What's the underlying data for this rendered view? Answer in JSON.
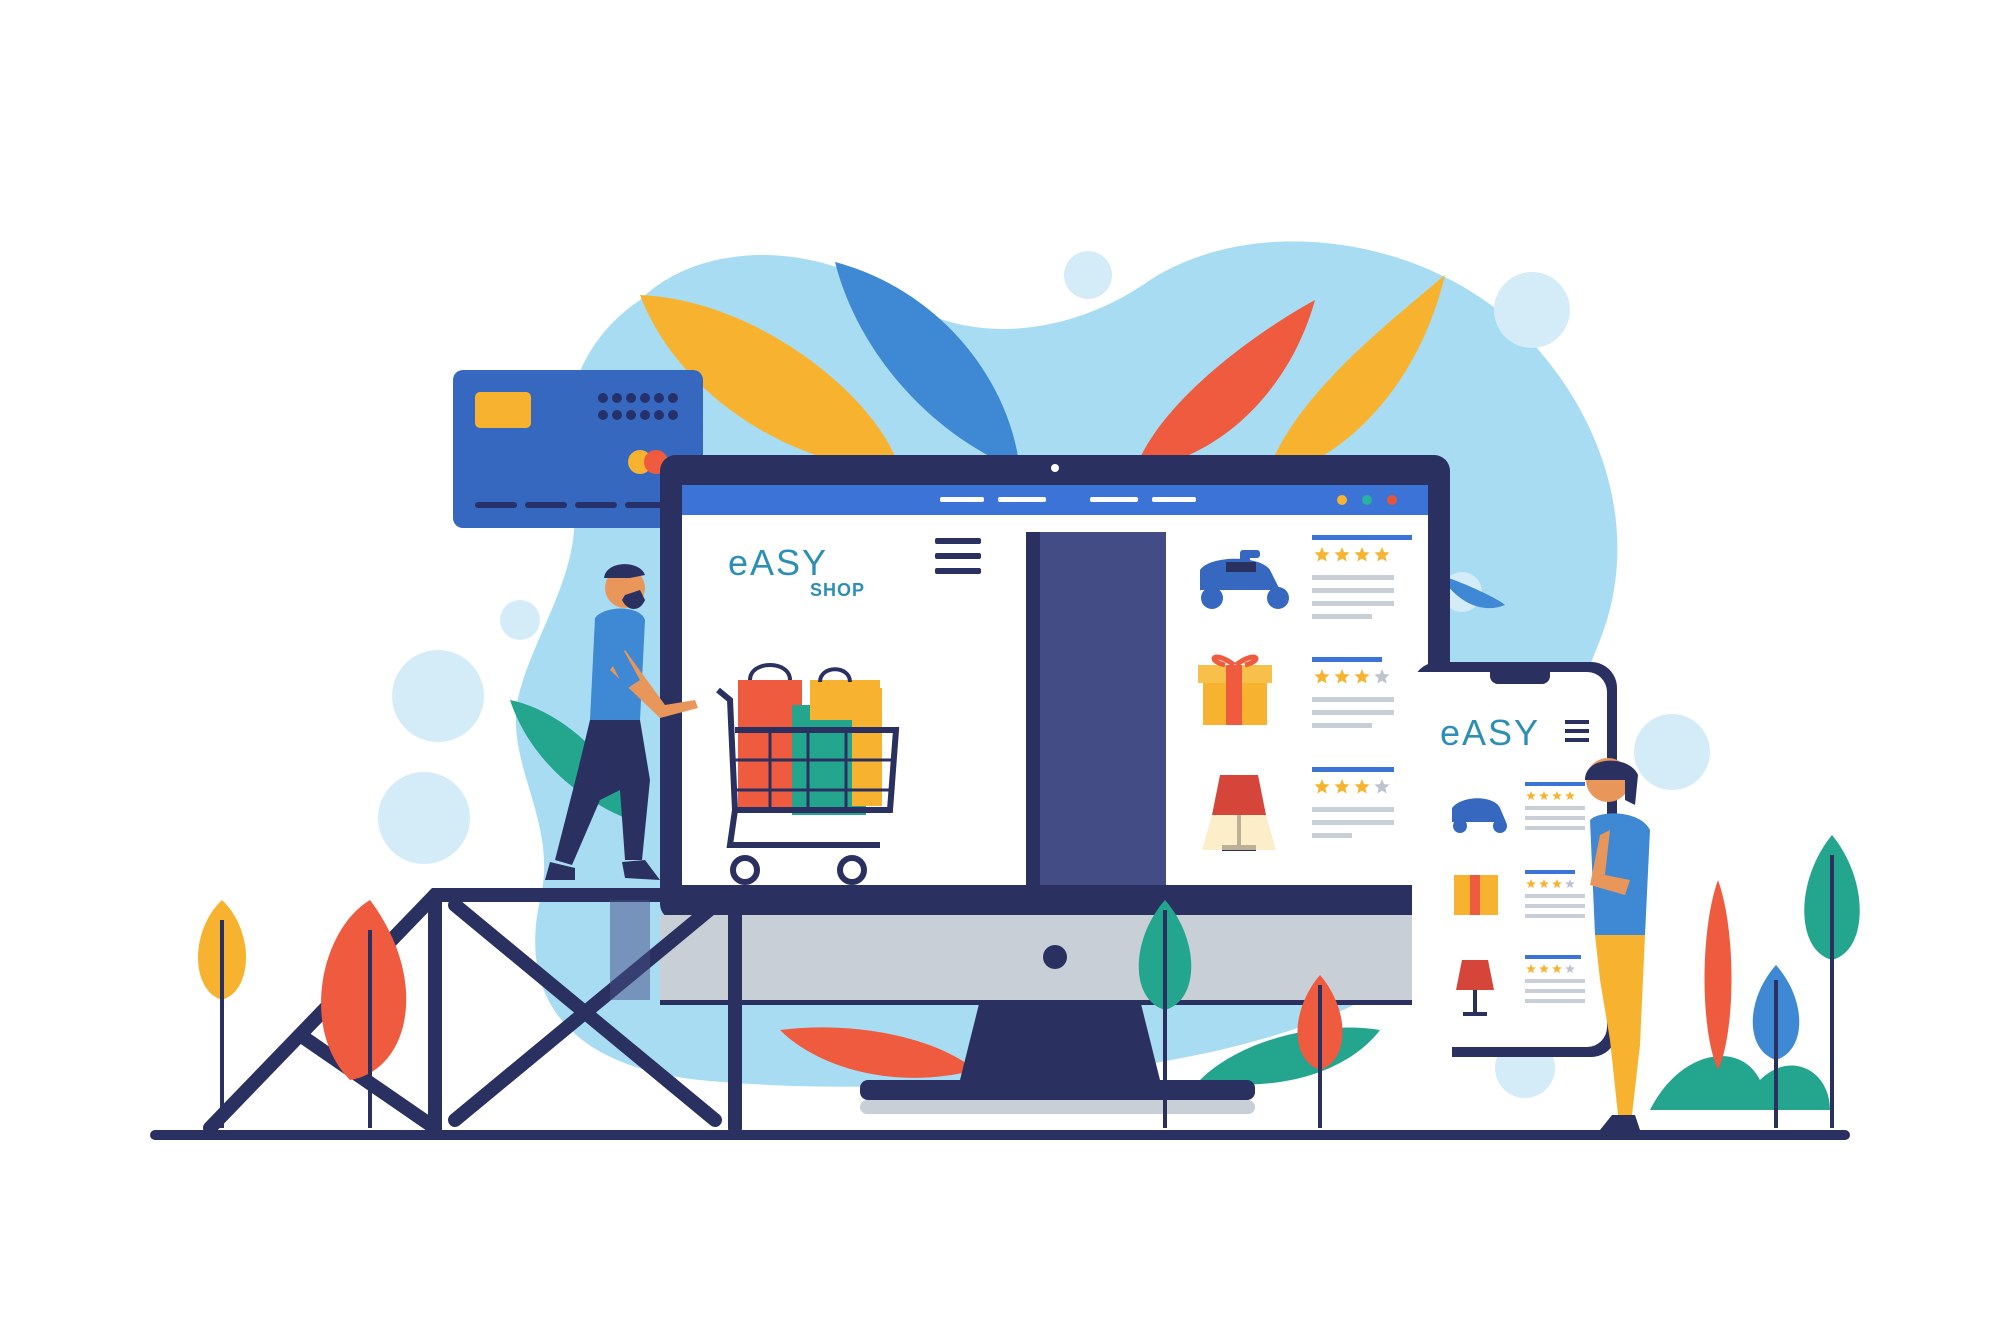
{
  "brand": {
    "logo_text_top": "eASY",
    "logo_text_bottom": "SHOP"
  },
  "desktop_browser": {
    "window_dots": [
      "#F6B431",
      "#29B0A0",
      "#E5553B"
    ],
    "products": [
      {
        "name": "scooter-icon",
        "stars_filled": 4,
        "stars_total": 4
      },
      {
        "name": "gift-box-icon",
        "stars_filled": 3,
        "stars_total": 4
      },
      {
        "name": "lamp-icon",
        "stars_filled": 3,
        "stars_total": 4
      }
    ]
  },
  "phone_app": {
    "products": [
      {
        "name": "scooter-icon",
        "stars_filled": 4,
        "stars_total": 4
      },
      {
        "name": "gift-box-icon",
        "stars_filled": 3,
        "stars_total": 4
      },
      {
        "name": "lamp-icon",
        "stars_filled": 3,
        "stars_total": 4
      }
    ]
  },
  "colors": {
    "navy": "#2A3160",
    "browser_blue": "#3C73D6",
    "blob_blue": "#A8DCF2",
    "orange": "#EF5B3F",
    "yellow": "#F7B32F",
    "teal": "#23A58E",
    "blue_leaf": "#3F88D3",
    "star": "#F6B431",
    "star_empty": "#BFC3CF"
  }
}
